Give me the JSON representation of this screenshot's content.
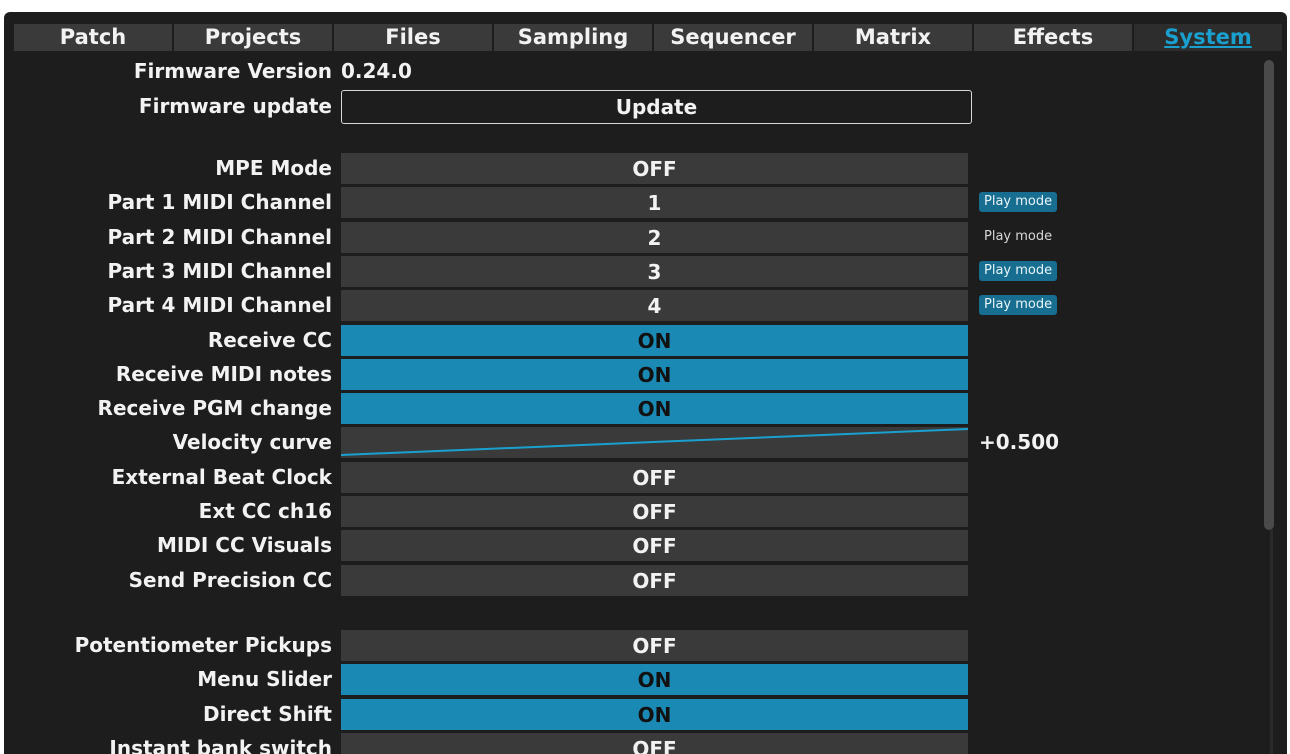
{
  "tabs": [
    "Patch",
    "Projects",
    "Files",
    "Sampling",
    "Sequencer",
    "Matrix",
    "Effects",
    "System"
  ],
  "active_tab": "System",
  "firmware": {
    "version_label": "Firmware Version",
    "version_value": "0.24.0",
    "update_label": "Firmware update",
    "update_button": "Update"
  },
  "settings": [
    {
      "label": "MPE Mode",
      "value": "OFF",
      "state": "off"
    },
    {
      "label": "Part 1 MIDI Channel",
      "value": "1",
      "state": "off",
      "badge": "Play mode",
      "badge_active": true
    },
    {
      "label": "Part 2 MIDI Channel",
      "value": "2",
      "state": "off",
      "badge": "Play mode",
      "badge_active": false
    },
    {
      "label": "Part 3 MIDI Channel",
      "value": "3",
      "state": "off",
      "badge": "Play mode",
      "badge_active": true
    },
    {
      "label": "Part 4 MIDI Channel",
      "value": "4",
      "state": "off",
      "badge": "Play mode",
      "badge_active": true
    },
    {
      "label": "Receive CC",
      "value": "ON",
      "state": "on"
    },
    {
      "label": "Receive MIDI notes",
      "value": "ON",
      "state": "on"
    },
    {
      "label": "Receive PGM change",
      "value": "ON",
      "state": "on"
    },
    {
      "label": "Velocity curve",
      "value": "",
      "state": "curve",
      "readout": "+0.500"
    },
    {
      "label": "External Beat Clock",
      "value": "OFF",
      "state": "off"
    },
    {
      "label": "Ext CC ch16",
      "value": "OFF",
      "state": "off"
    },
    {
      "label": "MIDI CC Visuals",
      "value": "OFF",
      "state": "off"
    },
    {
      "label": "Send Precision CC",
      "value": "OFF",
      "state": "off"
    }
  ],
  "settings2": [
    {
      "label": "Potentiometer Pickups",
      "value": "OFF",
      "state": "off"
    },
    {
      "label": "Menu Slider",
      "value": "ON",
      "state": "on"
    },
    {
      "label": "Direct Shift",
      "value": "ON",
      "state": "on"
    },
    {
      "label": "Instant bank switch",
      "value": "OFF",
      "state": "off"
    }
  ],
  "colors": {
    "background": "#1d1d1d",
    "cell": "#3a3a3a",
    "on": "#1a8ab5",
    "accent": "#1aa0cf",
    "badge": "#176e90"
  }
}
